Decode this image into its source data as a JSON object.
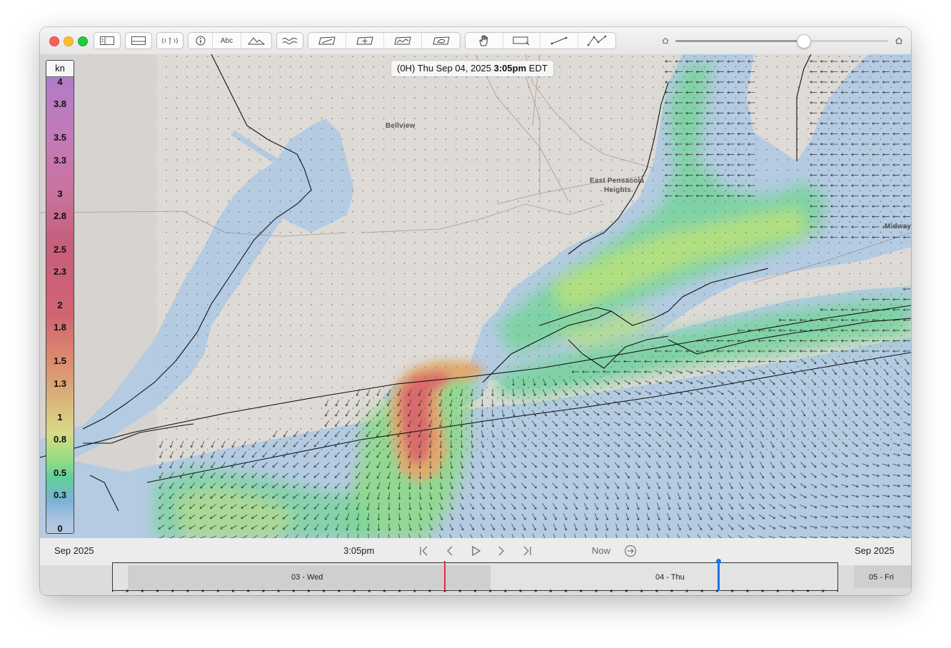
{
  "toolbar": {
    "groups": [
      {
        "name": "view",
        "buttons": [
          {
            "icon": "sidebar-icon"
          },
          {
            "icon": "bottom-panel-icon"
          }
        ]
      },
      {
        "name": "data",
        "buttons": [
          {
            "icon": "signal-icon"
          }
        ]
      },
      {
        "name": "annotate",
        "buttons": [
          {
            "icon": "info-icon"
          },
          {
            "icon": "label-icon",
            "label": "Abc"
          },
          {
            "icon": "terrain-icon"
          }
        ]
      },
      {
        "name": "layers",
        "buttons": [
          {
            "icon": "waves-icon"
          }
        ]
      },
      {
        "name": "route",
        "buttons": [
          {
            "icon": "route-edit-icon"
          },
          {
            "icon": "route-add-icon"
          },
          {
            "icon": "route-chart-icon"
          },
          {
            "icon": "route-region-icon"
          }
        ]
      },
      {
        "name": "tools",
        "buttons": [
          {
            "icon": "pan-hand-icon"
          },
          {
            "icon": "select-rect-icon"
          },
          {
            "icon": "measure-line-icon"
          },
          {
            "icon": "polyline-icon"
          }
        ]
      }
    ],
    "zoom": {
      "level": 0.6
    }
  },
  "map": {
    "time_prefix": "(0H) Thu Sep 04, 2025 ",
    "time_bold": "3:05pm",
    "time_suffix": " EDT",
    "places": [
      "Bellview",
      "East Pensacola",
      "Heights",
      "Midway"
    ],
    "colors": {
      "land": "#dedad6",
      "water": "#b4cbe2",
      "river": "#adc6e0"
    }
  },
  "legend": {
    "unit": "kn",
    "ticks": [
      "4",
      "3.8",
      "3.5",
      "3.3",
      "3",
      "2.8",
      "2.5",
      "2.3",
      "2",
      "1.8",
      "1.5",
      "1.3",
      "1",
      "0.8",
      "0.5",
      "0.3",
      "0"
    ]
  },
  "timeline": {
    "left_month": "Sep 2025",
    "current_time": "3:05pm",
    "now_label": "Now",
    "right_month": "Sep 2025",
    "days": [
      "03 - Wed",
      "04 - Thu",
      "05 - Fri"
    ],
    "colors": {
      "past_marker": "#d9343c",
      "current_marker": "#1a73e8"
    }
  }
}
